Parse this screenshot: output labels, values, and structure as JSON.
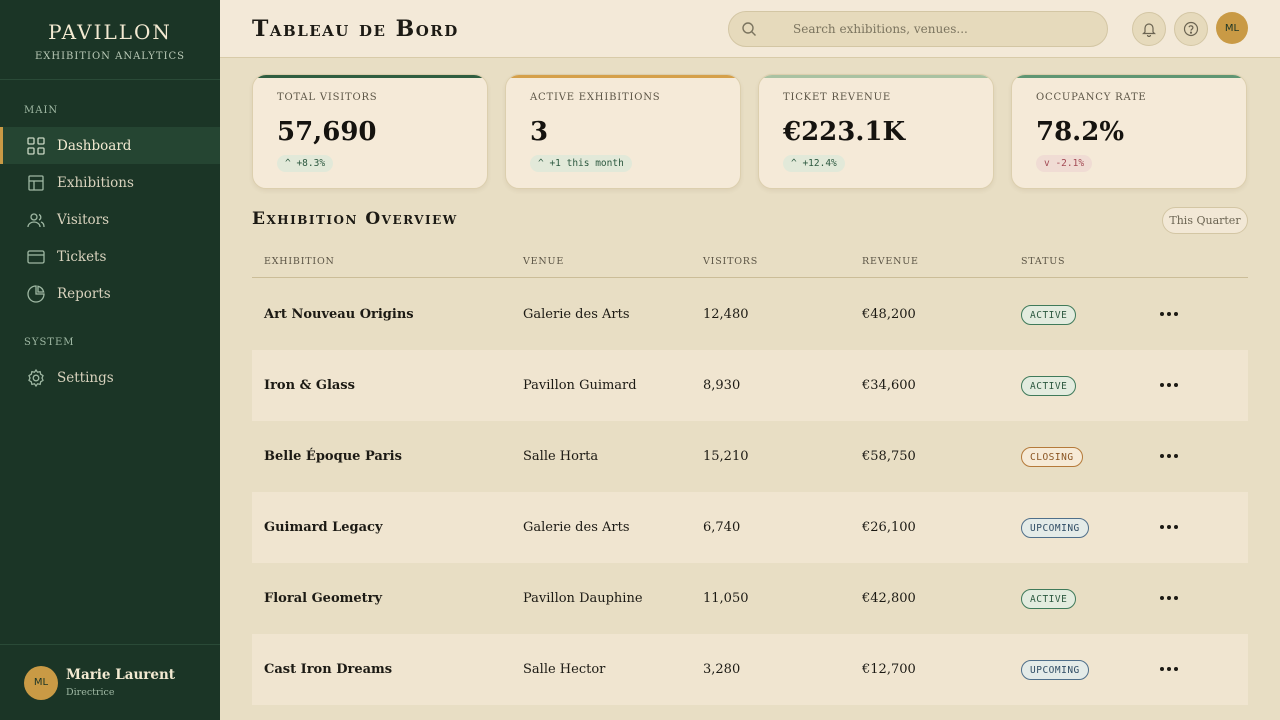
{
  "brand": {
    "title": "PAVILLON",
    "subtitle": "EXHIBITION ANALYTICS"
  },
  "sidebar": {
    "main_label": "MAIN",
    "system_label": "SYSTEM",
    "items": [
      {
        "label": "Dashboard",
        "icon": "grid-icon",
        "active": true
      },
      {
        "label": "Exhibitions",
        "icon": "layout-icon"
      },
      {
        "label": "Visitors",
        "icon": "users-icon"
      },
      {
        "label": "Tickets",
        "icon": "ticket-card-icon"
      },
      {
        "label": "Reports",
        "icon": "pie-chart-icon"
      }
    ],
    "system_items": [
      {
        "label": "Settings",
        "icon": "gear-icon"
      }
    ],
    "user": {
      "initials": "ML",
      "name": "Marie Laurent",
      "role": "Directrice"
    }
  },
  "header": {
    "title": "Tableau de Bord",
    "search_placeholder": "Search exhibitions, venues...",
    "avatar_initials": "ML"
  },
  "stats": [
    {
      "label": "TOTAL VISITORS",
      "value": "57,690",
      "change": "^ +8.3%",
      "trend": "up",
      "accent": "#2f5e40"
    },
    {
      "label": "ACTIVE EXHIBITIONS",
      "value": "3",
      "change": "^ +1 this month",
      "trend": "up",
      "accent": "#d5a04a"
    },
    {
      "label": "TICKET REVENUE",
      "value": "€223.1K",
      "change": "^ +12.4%",
      "trend": "up",
      "accent": "#a9c2a2"
    },
    {
      "label": "OCCUPANCY RATE",
      "value": "78.2%",
      "change": "v -2.1%",
      "trend": "down",
      "accent": "#5f9673"
    }
  ],
  "overview": {
    "title": "Exhibition Overview",
    "period_button": "This Quarter",
    "columns": [
      "EXHIBITION",
      "VENUE",
      "VISITORS",
      "REVENUE",
      "STATUS"
    ],
    "rows": [
      {
        "exhibition": "Art Nouveau Origins",
        "venue": "Galerie des Arts",
        "visitors": "12,480",
        "revenue": "€48,200",
        "status": "ACTIVE",
        "status_type": "active"
      },
      {
        "exhibition": "Iron & Glass",
        "venue": "Pavillon Guimard",
        "visitors": "8,930",
        "revenue": "€34,600",
        "status": "ACTIVE",
        "status_type": "active"
      },
      {
        "exhibition": "Belle Époque Paris",
        "venue": "Salle Horta",
        "visitors": "15,210",
        "revenue": "€58,750",
        "status": "CLOSING",
        "status_type": "closing"
      },
      {
        "exhibition": "Guimard Legacy",
        "venue": "Galerie des Arts",
        "visitors": "6,740",
        "revenue": "€26,100",
        "status": "UPCOMING",
        "status_type": "upcoming"
      },
      {
        "exhibition": "Floral Geometry",
        "venue": "Pavillon Dauphine",
        "visitors": "11,050",
        "revenue": "€42,800",
        "status": "ACTIVE",
        "status_type": "active"
      },
      {
        "exhibition": "Cast Iron Dreams",
        "venue": "Salle Hector",
        "visitors": "3,280",
        "revenue": "€12,700",
        "status": "UPCOMING",
        "status_type": "upcoming"
      }
    ]
  }
}
